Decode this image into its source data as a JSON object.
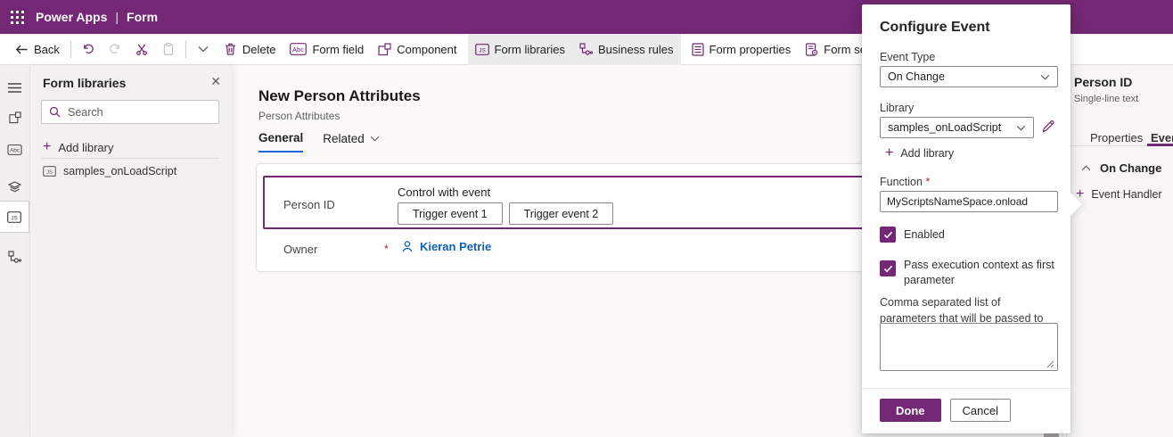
{
  "colors": {
    "brand": "#742774",
    "accent_blue": "#1160b7",
    "active_tab_blue": "#2266e3",
    "required_red": "#a4262c"
  },
  "app_bar": {
    "product": "Power Apps",
    "separator": "|",
    "page": "Form"
  },
  "toolbar": {
    "back": "Back",
    "delete": "Delete",
    "form_field": "Form field",
    "component": "Component",
    "form_libraries": "Form libraries",
    "business_rules": "Business rules",
    "form_properties": "Form properties",
    "form_settings": "Form settings"
  },
  "left_panel": {
    "title": "Form libraries",
    "search_placeholder": "Search",
    "add_library": "Add library",
    "items": [
      {
        "label": "samples_onLoadScript"
      }
    ]
  },
  "main": {
    "title": "New Person Attributes",
    "subtitle": "Person Attributes",
    "tabs": [
      {
        "label": "General"
      },
      {
        "label": "Related"
      }
    ],
    "form": {
      "rows": [
        {
          "label": "Person ID",
          "control_label": "Control with event",
          "buttons": [
            "Trigger event 1",
            "Trigger event 2"
          ]
        },
        {
          "label": "Owner",
          "required": "*",
          "value": "Kieran Petrie"
        }
      ]
    }
  },
  "dialog": {
    "title": "Configure Event",
    "event_type": {
      "label": "Event Type",
      "value": "On Change"
    },
    "library": {
      "label": "Library",
      "value": "samples_onLoadScript",
      "add": "Add library"
    },
    "function": {
      "label": "Function",
      "required": "*",
      "value": "MyScriptsNameSpace.onload"
    },
    "enabled": {
      "label": "Enabled",
      "checked": true
    },
    "pass_context": {
      "label": "Pass execution context as first parameter",
      "checked": true
    },
    "parameters": {
      "label": "Comma separated list of parameters that will be passed to the function",
      "value": ""
    },
    "done": "Done",
    "cancel": "Cancel"
  },
  "right_panel": {
    "title": "Person ID",
    "subtitle": "Single-line text",
    "tabs": [
      {
        "label": "Properties"
      },
      {
        "label": "Events"
      }
    ],
    "section": "On Change",
    "add_handler": "Event Handler"
  }
}
